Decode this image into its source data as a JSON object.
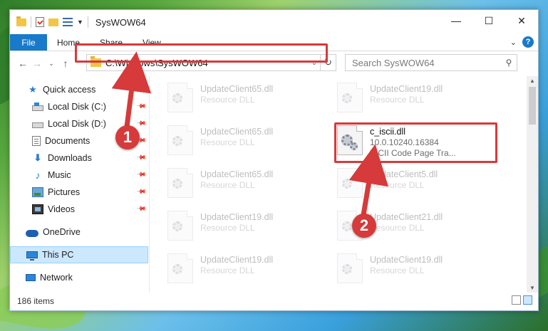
{
  "window": {
    "title": "SysWOW64",
    "controls": {
      "minimize": "—",
      "maximize": "☐",
      "close": "✕"
    }
  },
  "ribbon": {
    "tabs": [
      "File",
      "Home",
      "Share",
      "View"
    ],
    "help": "?"
  },
  "address": {
    "path": "C:\\Windows\\SysWOW64",
    "search_placeholder": "Search SysWOW64"
  },
  "sidebar": {
    "items": [
      {
        "label": "Quick access",
        "icon": "star-icon"
      },
      {
        "label": "Local Disk (C:)",
        "icon": "disk-icon",
        "pinned": true
      },
      {
        "label": "Local Disk (D:)",
        "icon": "disk-icon",
        "pinned": true
      },
      {
        "label": "Documents",
        "icon": "documents-icon",
        "pinned": true
      },
      {
        "label": "Downloads",
        "icon": "downloads-icon",
        "pinned": true
      },
      {
        "label": "Music",
        "icon": "music-icon",
        "pinned": true
      },
      {
        "label": "Pictures",
        "icon": "pictures-icon",
        "pinned": true
      },
      {
        "label": "Videos",
        "icon": "videos-icon",
        "pinned": true
      },
      {
        "label": "OneDrive",
        "icon": "onedrive-icon"
      },
      {
        "label": "This PC",
        "icon": "this-pc-icon",
        "selected": true
      },
      {
        "label": "Network",
        "icon": "network-icon"
      }
    ]
  },
  "files": [
    {
      "name": "UpdateClient65.dll",
      "sub1": "Resource DLL",
      "sub2": ""
    },
    {
      "name": "UpdateClient19.dll",
      "sub1": "Resource DLL",
      "sub2": ""
    },
    {
      "name": "UpdateClient65.dll",
      "sub1": "Resource DLL",
      "sub2": ""
    },
    {
      "name": "c_iscii.dll",
      "sub1": "10.0.10240.16384",
      "sub2": "ISCII Code Page Tra...",
      "focused": true
    },
    {
      "name": "UpdateClient65.dll",
      "sub1": "Resource DLL",
      "sub2": ""
    },
    {
      "name": "UpdateClient5.dll",
      "sub1": "Resource DLL",
      "sub2": ""
    },
    {
      "name": "UpdateClient19.dll",
      "sub1": "Resource DLL",
      "sub2": ""
    },
    {
      "name": "UpdateClient21.dll",
      "sub1": "Resource DLL",
      "sub2": ""
    },
    {
      "name": "UpdateClient19.dll",
      "sub1": "Resource DLL",
      "sub2": ""
    },
    {
      "name": "UpdateClient19.dll",
      "sub1": "Resource DLL",
      "sub2": ""
    }
  ],
  "status": {
    "item_count": "186 items"
  },
  "callouts": [
    "1",
    "2"
  ],
  "colors": {
    "accent": "#1979ca",
    "highlight": "#d63a3a",
    "selection": "#cce8ff"
  }
}
